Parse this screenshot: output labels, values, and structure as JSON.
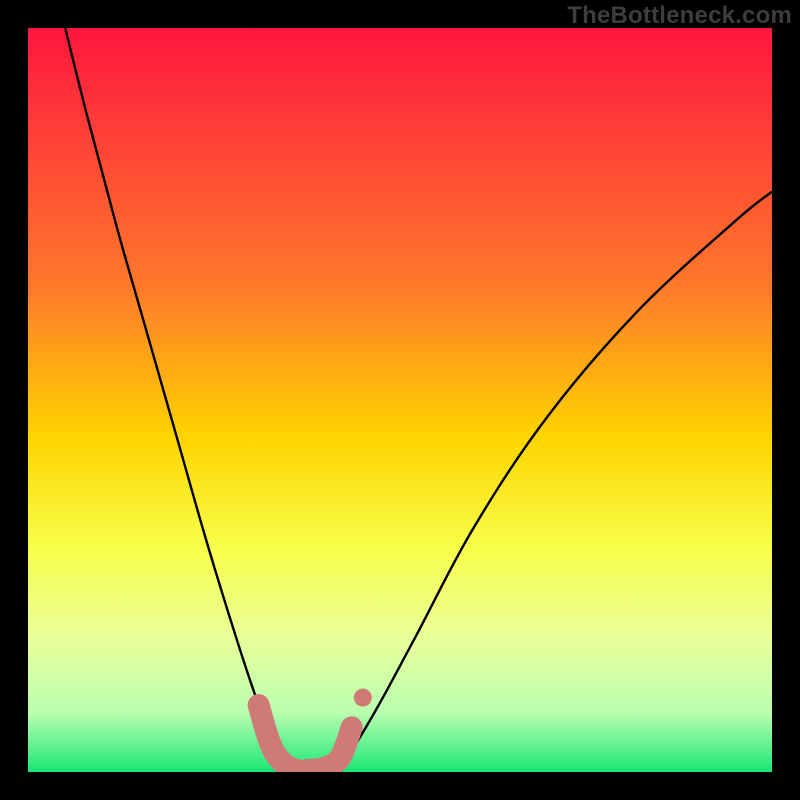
{
  "watermark": "TheBottleneck.com",
  "chart_data": {
    "type": "line",
    "title": "",
    "xlabel": "",
    "ylabel": "",
    "xlim": [
      0,
      100
    ],
    "ylim": [
      0,
      100
    ],
    "gradient_stops": [
      {
        "offset": 0,
        "color": "#ff163f"
      },
      {
        "offset": 35,
        "color": "#ff7a2a"
      },
      {
        "offset": 55,
        "color": "#ffd400"
      },
      {
        "offset": 70,
        "color": "#f7ff4a"
      },
      {
        "offset": 82,
        "color": "#eaff9a"
      },
      {
        "offset": 92,
        "color": "#baffb0"
      },
      {
        "offset": 100,
        "color": "#19e676"
      }
    ],
    "series": [
      {
        "name": "bottleneck-curve",
        "x": [
          5,
          8,
          12,
          16,
          20,
          24,
          28,
          31,
          33,
          35,
          37,
          39,
          42,
          46,
          52,
          60,
          70,
          82,
          95,
          100
        ],
        "y": [
          100,
          88,
          73,
          59,
          45,
          31,
          18,
          9,
          4,
          1,
          0,
          0,
          1,
          7,
          18,
          33,
          48,
          62,
          74,
          78
        ]
      }
    ],
    "highlight_band": {
      "name": "optimal-range",
      "color": "#d07a78",
      "points_x": [
        31.0,
        32.5,
        34.0,
        36.0,
        38.0,
        40.0,
        42.0,
        43.5
      ],
      "points_y": [
        9.0,
        4.0,
        1.5,
        0.3,
        0.3,
        0.6,
        2.0,
        6.0
      ],
      "endpoint": {
        "x": 45.0,
        "y": 10.0
      }
    }
  }
}
